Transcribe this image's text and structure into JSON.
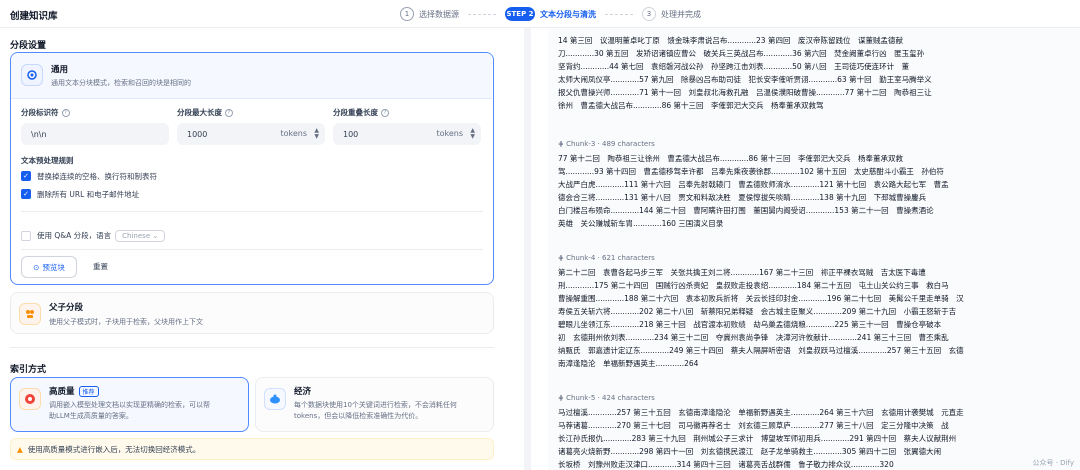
{
  "header": {
    "app_title": "创建知识库",
    "steps": [
      {
        "num": "1",
        "label": "选择数据源"
      },
      {
        "num": "STEP 2",
        "label": "文本分段与清洗"
      },
      {
        "num": "3",
        "label": "处理并完成"
      }
    ]
  },
  "left": {
    "segment_title": "分段设置",
    "general": {
      "title": "通用",
      "desc": "通用文本分块模式，检索和召回的块是相同的",
      "fields": [
        {
          "label": "分段标识符",
          "value": "\\n\\n",
          "unit": ""
        },
        {
          "label": "分段最大长度",
          "value": "1000",
          "unit": "tokens"
        },
        {
          "label": "分段重叠长度",
          "value": "100",
          "unit": "tokens"
        }
      ],
      "rules_title": "文本预处理规则",
      "rules": [
        {
          "label": "替换掉连续的空格、换行符和制表符",
          "checked": true
        },
        {
          "label": "删除所有 URL 和电子邮件地址",
          "checked": true
        }
      ],
      "qa": {
        "label": "使用 Q&A 分段，语言",
        "lang": "Chinese",
        "checked": false
      },
      "preview_btn": "预览块",
      "reset_btn": "重置"
    },
    "parent_child": {
      "title": "父子分段",
      "desc": "使用父子模式时，子块用于检索，父块用作上下文"
    },
    "index_title": "索引方式",
    "high_quality": {
      "title": "高质量",
      "badge": "推荐",
      "desc1": "调用嵌入模型处理文档以实现更精确的检索，可以帮",
      "desc2": "助LLM生成高质量的答案。"
    },
    "economy": {
      "title": "经济",
      "desc1": "每个数据块使用10个关键词进行检索，不会消耗任何",
      "desc2": "tokens，但会以降低检索准确性为代价。"
    },
    "warning": "使用高质量模式进行嵌入后，无法切换回经济模式。"
  },
  "right": {
    "chunk2": {
      "lines": [
        "14 第三回　议温明董卓叱丁原　馈金珠李肃说吕布............23 第四回　废汉帝陈留践位　谋董贼孟德献",
        "刀............30 第五回　发矫诏诸镇应曹公　破关兵三英战吕布............36 第六回　焚金阙董卓行凶　匿玉玺孙",
        "坚背约............44 第七回　袁绍磐河战公孙　孙坚跨江击刘表............50 第八回　王司徒巧使连环计　董",
        "太师大闹凤仪亭............57 第九回　除暴凶吕布助司徒　犯长安李傕听贾诩............63 第十回　勤王室马腾举义",
        "报父仇曹操兴师............71 第十一回　刘皇叔北海救孔融　吕温侯濮阳破曹操............77 第十二回　陶恭祖三让",
        "徐州　曹孟德大战吕布............86 第十三回　李傕郭汜大交兵　杨奉董承双救驾"
      ]
    },
    "chunk3": {
      "title": "Chunk-3 · 489 characters",
      "lines": [
        "77 第十二回　陶恭祖三让徐州　曹孟德大战吕布............86 第十三回　李傕郭汜大交兵　杨奉董承双救",
        "驾............93 第十四回　曹孟德移驾幸许都　吕奉先乘夜袭徐郡............102 第十五回　太史慈酣斗小霸王　孙伯符",
        "大战严白虎............111 第十六回　吕奉先射戟辕门　曹孟德败师淯水............121 第十七回　袁公路大起七军　曹孟",
        "德会合三将............131 第十八回　贾文和料敌决胜　夏侯惇拔矢啖睛............138 第十九回　下邳城曹操鏖兵",
        "白门楼吕布殒命............144 第二十回　曹阿瞒许田打围　董国舅内阁受诏............153 第二十一回　曹操煮酒论",
        "英雄　关公赚城斩车胄............160 三国演义目录"
      ]
    },
    "chunk4": {
      "title": "Chunk-4 · 621 characters",
      "lines": [
        "第二十二回　袁曹各起马步三军　关张共擒王刘二将............167 第二十三回　祢正平裸衣骂贼　吉太医下毒遭",
        "刑............175 第二十四回　国贼行凶杀贵妃　皇叔败走投袁绍............184 第二十五回　屯土山关公约三事　救白马",
        "曹操解重围............188 第二十六回　袁本初败兵折将　关云长挂印封金............196 第二十七回　美髯公千里走单骑　汉",
        "寿侯五关斩六将............202 第二十八回　斩蔡阳兄弟释疑　会古城主臣聚义............209 第二十九回　小霸王怒斩于吉",
        "碧眼儿坐领江东............218 第三十回　战官渡本初败绩　劫乌巢孟德烧粮............225 第三十一回　曹操仓亭破本",
        "初　玄德荆州依刘表............234 第三十二回　夺冀州袁尚争锋　决漳河许攸献计............241 第三十三回　曹丕乘乱",
        "纳甄氏　郭嘉遗计定辽东............249 第三十四回　蔡夫人隔屏听密语　刘皇叔跃马过檀溪............257 第三十五回　玄德",
        "南漳逢隐沦　单福新野遇英主............264"
      ]
    },
    "chunk5": {
      "title": "Chunk-5 · 424 characters",
      "lines": [
        "马过檀溪............257 第三十五回　玄德南漳逢隐沦　单福新野遇英主............264 第三十六回　玄德用计袭樊城　元直走",
        "马荐诸葛............270 第三十七回　司马徽再荐名士　刘玄德三顾草庐............277 第三十八回　定三分隆中决策　战",
        "长江孙氏报仇............283 第三十九回　荆州城公子三求计　博望坡军师初用兵............291 第四十回　蔡夫人议献荆州",
        "诸葛亮火烧新野............298 第四十一回　刘玄德携民渡江　赵子龙单骑救主............305 第四十二回　张翼德大闹",
        "长坂桥　刘豫州败走汉津口............314 第四十三回　诸葛亮舌战群儒　鲁子敬力排众议............320"
      ]
    },
    "watermark": "公众号 · Dify"
  }
}
